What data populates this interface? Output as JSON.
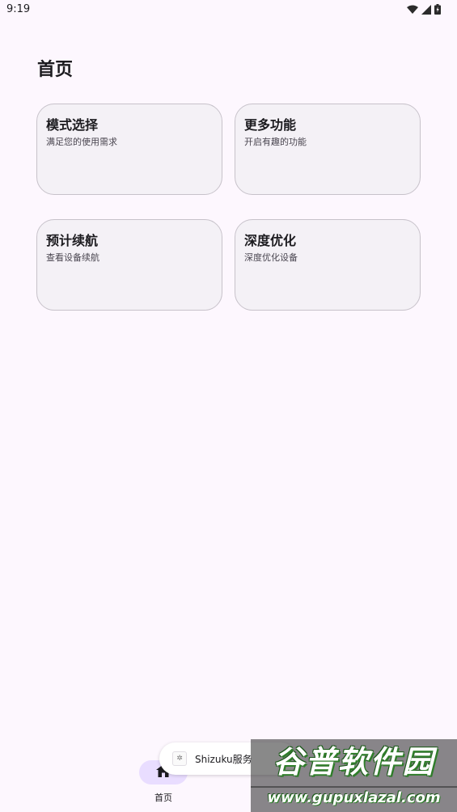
{
  "status_bar": {
    "time": "9:19",
    "icons": [
      "wifi-icon",
      "signal-icon",
      "battery-icon"
    ]
  },
  "page": {
    "title": "首页"
  },
  "cards": [
    {
      "title": "模式选择",
      "subtitle": "满足您的使用需求"
    },
    {
      "title": "更多功能",
      "subtitle": "开启有趣的功能"
    },
    {
      "title": "预计续航",
      "subtitle": "查看设备续航"
    },
    {
      "title": "深度优化",
      "subtitle": "深度优化设备"
    }
  ],
  "bottom_nav": {
    "items": [
      {
        "label": "首页",
        "icon": "home-icon",
        "selected": true
      }
    ]
  },
  "toast": {
    "text": "Shizuku服务"
  },
  "watermark": {
    "title": "谷普软件园",
    "url": "www.gupuxlazal.com"
  },
  "colors": {
    "background": "#fdf7fe",
    "card": "#f4f1f6",
    "nav_indicator": "#e9ddff"
  }
}
